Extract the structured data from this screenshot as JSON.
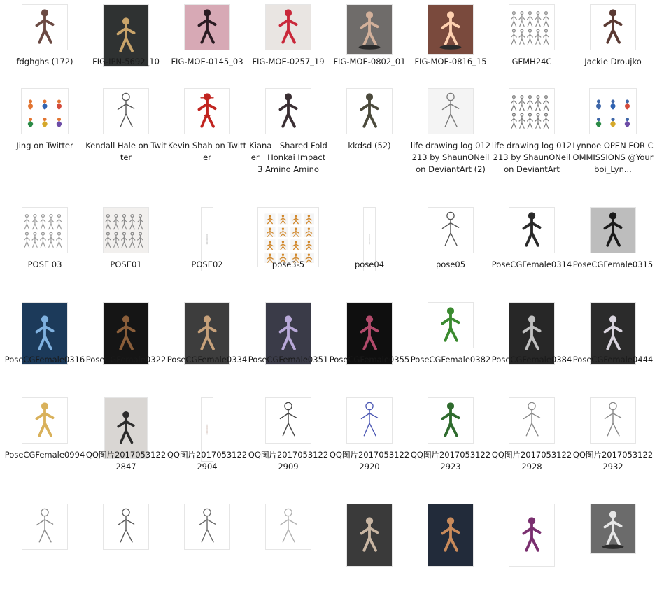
{
  "files": [
    {
      "label": "fdghghs (172)",
      "thumb": "dark-pose",
      "bg": "#ffffff",
      "fg": "#6b4a43"
    },
    {
      "label": "FIG-IPN-5692_10",
      "thumb": "dark-photo",
      "bg": "#2f3232",
      "fg": "#c9a46a"
    },
    {
      "label": "FIG-MOE-0145_03",
      "thumb": "legs-photo",
      "bg": "#d7a9b5",
      "fg": "#2a1b22"
    },
    {
      "label": "FIG-MOE-0257_19",
      "thumb": "red-figure",
      "bg": "#e9e5e2",
      "fg": "#c9283a"
    },
    {
      "label": "FIG-MOE-0802_01",
      "thumb": "figure-base",
      "bg": "#6f6c6a",
      "fg": "#d2b09a"
    },
    {
      "label": "FIG-MOE-0816_15",
      "thumb": "figure-base",
      "bg": "#7a4a3d",
      "fg": "#ffd1b0"
    },
    {
      "label": "GFMH24C",
      "thumb": "sketch-sheet",
      "bg": "#ffffff",
      "fg": "#8c8c8c"
    },
    {
      "label": "Jackie Droujko",
      "thumb": "dancer",
      "bg": "#ffffff",
      "fg": "#5b3a33"
    },
    {
      "label": "Jing on Twitter",
      "thumb": "color-sheet",
      "bg": "#ffffff",
      "fg": "#e27532"
    },
    {
      "label": "Kendall Hale on Twitter",
      "thumb": "line-sketch",
      "bg": "#ffffff",
      "fg": "#555555"
    },
    {
      "label": "Kevin Shah on Twitter",
      "thumb": "spider",
      "bg": "#ffffff",
      "fg": "#c1241f"
    },
    {
      "label": "Kiana　Shared Folder　Honkai Impact 3 Amino Amino",
      "thumb": "anime-figure",
      "bg": "#ffffff",
      "fg": "#3a2f33"
    },
    {
      "label": "kkdsd (52)",
      "thumb": "kneel",
      "bg": "#ffffff",
      "fg": "#4b4a3c"
    },
    {
      "label": "life drawing log 012213 by ShaunONeil on DeviantArt (2)",
      "thumb": "grey-sketch",
      "bg": "#f4f4f4",
      "fg": "#7a7a7a"
    },
    {
      "label": "life drawing log 012213 by ShaunONeil on DeviantArt",
      "thumb": "grey-sheet",
      "bg": "#ffffff",
      "fg": "#7a7a7a"
    },
    {
      "label": "Lynnoe OPEN FOR COMMISSIONS @Yourboi_Lyn...",
      "thumb": "color-sheet",
      "bg": "#ffffff",
      "fg": "#3e66a8"
    },
    {
      "label": "POSE 03",
      "thumb": "sketch-sheet",
      "bg": "#ffffff",
      "fg": "#9a9a9a"
    },
    {
      "label": "POSE01",
      "thumb": "sketch-sheet",
      "bg": "#f2f0ee",
      "fg": "#8a8a8a"
    },
    {
      "label": "POSE02",
      "thumb": "tall-strip",
      "bg": "#ffffff",
      "fg": "#9a9a9a"
    },
    {
      "label": "pose3-5",
      "thumb": "grid-sheet",
      "bg": "#ffffff",
      "fg": "#d1882c"
    },
    {
      "label": "pose04",
      "thumb": "tall-strip",
      "bg": "#ffffff",
      "fg": "#b0b0b0"
    },
    {
      "label": "pose05",
      "thumb": "line-sketch",
      "bg": "#ffffff",
      "fg": "#555555"
    },
    {
      "label": "PoseCGFemale0314",
      "thumb": "anime-figure",
      "bg": "#ffffff",
      "fg": "#2a2a2a"
    },
    {
      "label": "PoseCGFemale0315",
      "thumb": "anime-figure",
      "bg": "#bdbdbd",
      "fg": "#1a1a1a"
    },
    {
      "label": "PoseCGFemale0316",
      "thumb": "dark-photo",
      "bg": "#1c3a5a",
      "fg": "#7fb1e0"
    },
    {
      "label": "PoseCGFemale0322",
      "thumb": "dark-photo",
      "bg": "#151515",
      "fg": "#8a5e3a"
    },
    {
      "label": "PoseCGFemale0334",
      "thumb": "dark-photo",
      "bg": "#3d3d3d",
      "fg": "#c7a17a"
    },
    {
      "label": "PoseCGFemale0351",
      "thumb": "dark-photo",
      "bg": "#3a3b48",
      "fg": "#b8a9d8"
    },
    {
      "label": "PoseCGFemale0355",
      "thumb": "dark-photo",
      "bg": "#0f0f0f",
      "fg": "#b24a6b"
    },
    {
      "label": "PoseCGFemale0382",
      "thumb": "red-figure",
      "bg": "#ffffff",
      "fg": "#3a8a2f"
    },
    {
      "label": "PoseCGFemale0384",
      "thumb": "dark-photo",
      "bg": "#272727",
      "fg": "#bfbfbf"
    },
    {
      "label": "PoseCGFemale0444",
      "thumb": "dark-photo",
      "bg": "#2b2b2b",
      "fg": "#d9d4de"
    },
    {
      "label": "PoseCGFemale0994",
      "thumb": "anime-figure",
      "bg": "#ffffff",
      "fg": "#d9b15b"
    },
    {
      "label": "QQ图片20170531222847",
      "thumb": "photo-squat",
      "bg": "#d9d6d3",
      "fg": "#2c2c2c"
    },
    {
      "label": "QQ图片20170531222904",
      "thumb": "tall-strip",
      "bg": "#ffffff",
      "fg": "#c09a8a"
    },
    {
      "label": "QQ图片20170531222909",
      "thumb": "line-sketch",
      "bg": "#ffffff",
      "fg": "#444444"
    },
    {
      "label": "QQ图片20170531222920",
      "thumb": "line-sketch",
      "bg": "#ffffff",
      "fg": "#4b57b3"
    },
    {
      "label": "QQ图片20170531222923",
      "thumb": "red-figure",
      "bg": "#ffffff",
      "fg": "#2f6b2e"
    },
    {
      "label": "QQ图片20170531222928",
      "thumb": "grey-sketch",
      "bg": "#ffffff",
      "fg": "#8a8a8a"
    },
    {
      "label": "QQ图片20170531222932",
      "thumb": "grey-sketch",
      "bg": "#ffffff",
      "fg": "#8a8a8a"
    },
    {
      "label": "",
      "thumb": "grey-sketch",
      "bg": "#ffffff",
      "fg": "#8a8a8a"
    },
    {
      "label": "",
      "thumb": "line-sketch",
      "bg": "#ffffff",
      "fg": "#5a5a5a"
    },
    {
      "label": "",
      "thumb": "line-sketch",
      "bg": "#ffffff",
      "fg": "#6a6a6a"
    },
    {
      "label": "",
      "thumb": "grey-sketch",
      "bg": "#ffffff",
      "fg": "#b0b0b0"
    },
    {
      "label": "",
      "thumb": "dark-photo",
      "bg": "#3a3a3a",
      "fg": "#c9b6a3"
    },
    {
      "label": "",
      "thumb": "dark-photo",
      "bg": "#222b3a",
      "fg": "#c98a5a"
    },
    {
      "label": "",
      "thumb": "dark-photo",
      "bg": "#ffffff",
      "fg": "#7a2f6f"
    },
    {
      "label": "",
      "thumb": "figure-base",
      "bg": "#6b6b6b",
      "fg": "#e6e6e6"
    }
  ]
}
